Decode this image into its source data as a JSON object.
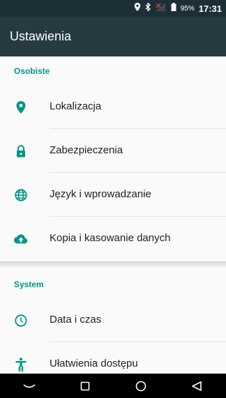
{
  "status_bar": {
    "battery_percent": "95%",
    "time": "17:31",
    "icons": [
      "location-icon",
      "bluetooth-icon",
      "signal-icon",
      "battery-icon"
    ]
  },
  "app_bar": {
    "title": "Ustawienia"
  },
  "sections": [
    {
      "header": "Osobiste",
      "items": [
        {
          "label": "Lokalizacja",
          "icon": "location-pin-icon"
        },
        {
          "label": "Zabezpieczenia",
          "icon": "lock-icon"
        },
        {
          "label": "Język i wprowadzanie",
          "icon": "globe-icon"
        },
        {
          "label": "Kopia i kasowanie danych",
          "icon": "cloud-upload-icon"
        }
      ]
    },
    {
      "header": "System",
      "items": [
        {
          "label": "Data i czas",
          "icon": "clock-icon"
        },
        {
          "label": "Ułatwienia dostępu",
          "icon": "accessibility-icon"
        }
      ]
    }
  ],
  "nav_bar": {
    "buttons": [
      "hide-keyboard",
      "recents",
      "home",
      "back"
    ]
  },
  "colors": {
    "accent": "#009688",
    "app_bar": "#263a42",
    "status_bar": "#1d2f36",
    "background": "#fafafa"
  }
}
